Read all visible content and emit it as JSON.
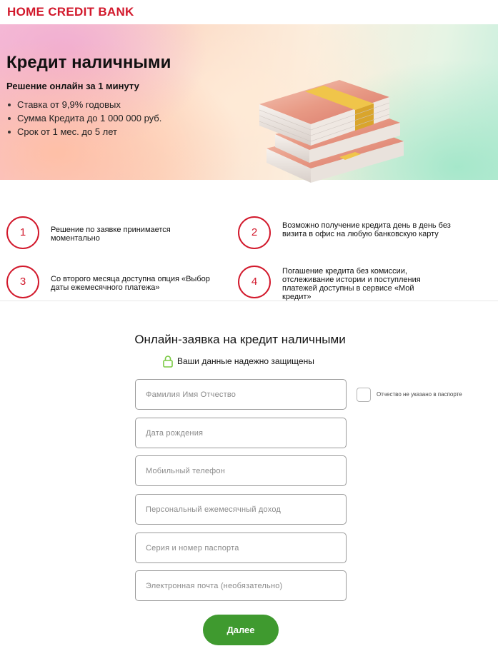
{
  "header": {
    "logo_text": "HOME CREDIT BANK"
  },
  "hero": {
    "title": "Кредит наличными",
    "subtitle": "Решение онлайн за 1 минуту",
    "bullets": [
      "Ставка от 9,9% годовых",
      "Сумма Кредита до 1 000 000 руб.",
      "Срок от 1 мес. до 5 лет"
    ]
  },
  "features": [
    {
      "number": "1",
      "text": "Решение по заявке принимается моментально"
    },
    {
      "number": "2",
      "text": "Возможно получение кредита день в день без визита в офис на любую банковскую карту"
    },
    {
      "number": "3",
      "text": "Со второго месяца доступна опция «Выбор даты ежемесячного платежа»"
    },
    {
      "number": "4",
      "text": "Погашение кредита без комиссии, отслеживание истории и поступления платежей доступны в сервисе «Мой кредит»"
    }
  ],
  "form": {
    "title": "Онлайн-заявка на кредит наличными",
    "secure_text": "Ваши данные надежно защищены",
    "fields": [
      {
        "placeholder": "Фамилия Имя Отчество",
        "value": ""
      },
      {
        "placeholder": "Дата рождения",
        "value": ""
      },
      {
        "placeholder": "Мобильный телефон",
        "value": ""
      },
      {
        "placeholder": "Персональный ежемесячный доход",
        "value": ""
      },
      {
        "placeholder": "Серия и номер паспорта",
        "value": ""
      },
      {
        "placeholder": "Электронная почта (необязательно)",
        "value": ""
      }
    ],
    "no_patronymic_label": "Отчество не указано в паспорте",
    "submit_label": "Далее"
  },
  "colors": {
    "brand_red": "#d2192c",
    "button_green": "#3f9a2f",
    "lock_green": "#7ac943"
  },
  "icons": {
    "lock": "lock-icon",
    "money": "money-stack-illustration"
  }
}
